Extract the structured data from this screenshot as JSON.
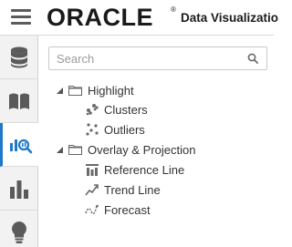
{
  "header": {
    "brand": "ORACLE",
    "registered_mark": "®",
    "product": "Data Visualizatio"
  },
  "rail": {
    "tabs": [
      {
        "icon": "database-icon",
        "active": false
      },
      {
        "icon": "book-icon",
        "active": false
      },
      {
        "icon": "analytics-search-icon",
        "active": true
      },
      {
        "icon": "bar-chart-icon",
        "active": false
      },
      {
        "icon": "lightbulb-icon",
        "active": false
      }
    ],
    "accent_color": "#1f78c8"
  },
  "search": {
    "placeholder": "Search",
    "value": ""
  },
  "tree": {
    "groups": [
      {
        "label": "Highlight",
        "expanded": true,
        "items": [
          {
            "label": "Clusters",
            "icon": "clusters-icon"
          },
          {
            "label": "Outliers",
            "icon": "outliers-icon"
          }
        ]
      },
      {
        "label": "Overlay & Projection",
        "expanded": true,
        "items": [
          {
            "label": "Reference Line",
            "icon": "reference-line-icon"
          },
          {
            "label": "Trend Line",
            "icon": "trend-line-icon"
          },
          {
            "label": "Forecast",
            "icon": "forecast-icon"
          }
        ]
      }
    ]
  }
}
